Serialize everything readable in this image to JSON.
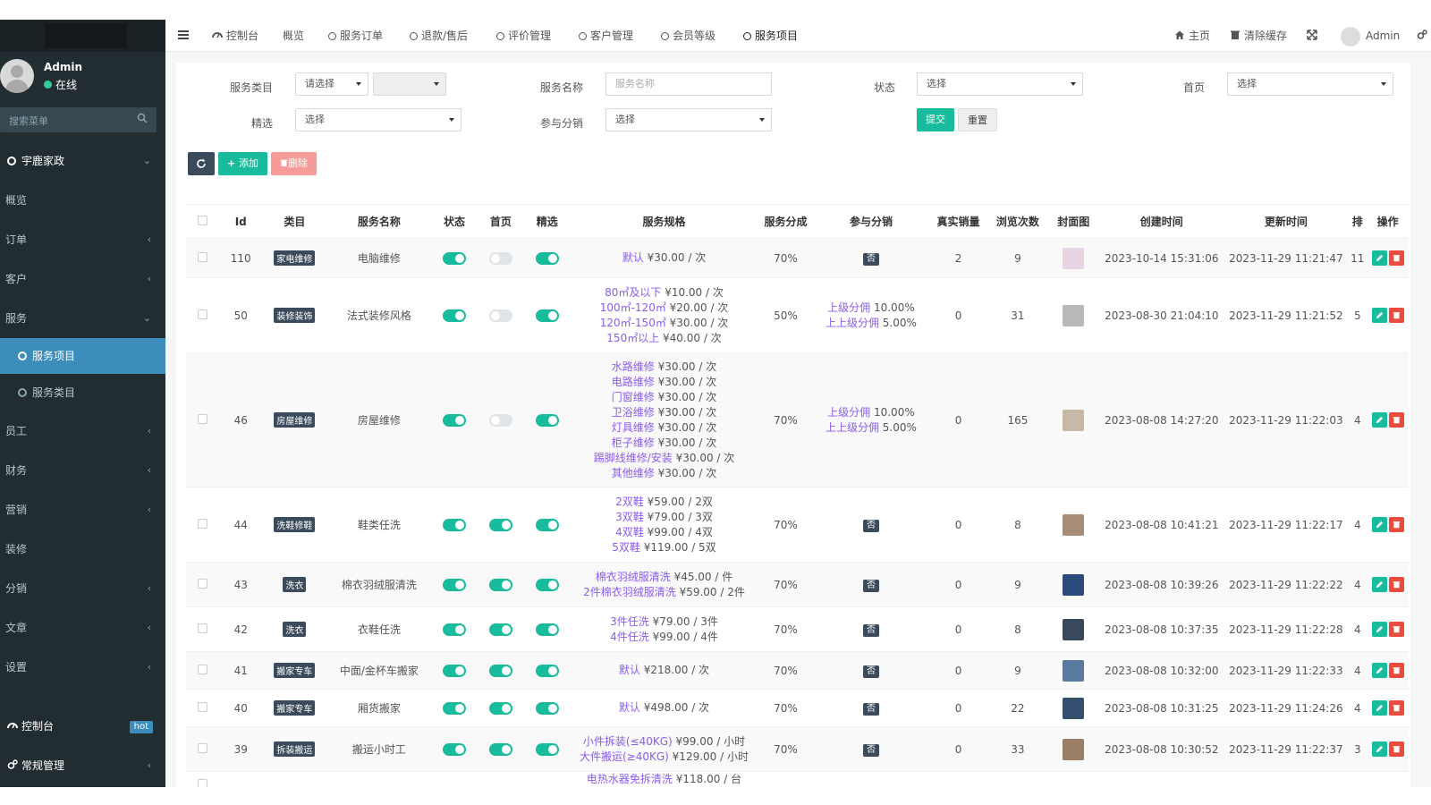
{
  "sidebar": {
    "user": {
      "name": "Admin",
      "status": "在线"
    },
    "search_placeholder": "搜索菜单",
    "items": [
      {
        "label": "宇鹿家政",
        "arrow": "⌄"
      },
      {
        "label": "概览",
        "arrow": ""
      },
      {
        "label": "订单",
        "arrow": "‹"
      },
      {
        "label": "客户",
        "arrow": "‹"
      },
      {
        "label": "服务",
        "arrow": "⌄"
      },
      {
        "label": "服务项目",
        "arrow": ""
      },
      {
        "label": "服务类目",
        "arrow": ""
      },
      {
        "label": "员工",
        "arrow": "‹"
      },
      {
        "label": "财务",
        "arrow": "‹"
      },
      {
        "label": "营销",
        "arrow": "‹"
      },
      {
        "label": "装修",
        "arrow": ""
      },
      {
        "label": "分销",
        "arrow": "‹"
      },
      {
        "label": "文章",
        "arrow": "‹"
      },
      {
        "label": "设置",
        "arrow": "‹"
      }
    ],
    "bottom": [
      {
        "label": "控制台",
        "badge": "hot"
      },
      {
        "label": "常规管理",
        "arrow": "‹"
      }
    ]
  },
  "navbar": {
    "tabs": [
      "控制台",
      "概览",
      "服务订单",
      "退款/售后",
      "评价管理",
      "客户管理",
      "会员等级",
      "服务项目"
    ],
    "right": {
      "home": "主页",
      "clear_cache": "清除缓存",
      "user": "Admin"
    }
  },
  "filters": {
    "category_label": "服务类目",
    "category_value": "请选择",
    "name_label": "服务名称",
    "name_placeholder": "服务名称",
    "status_label": "状态",
    "status_value": "选择",
    "home_label": "首页",
    "home_value": "选择",
    "featured_label": "精选",
    "featured_value": "选择",
    "distribution_label": "参与分销",
    "distribution_value": "选择",
    "submit": "提交",
    "reset": "重置"
  },
  "toolbar": {
    "add": "添加",
    "delete": "删除"
  },
  "table": {
    "headers": [
      "Id",
      "类目",
      "服务名称",
      "状态",
      "首页",
      "精选",
      "服务规格",
      "服务分成",
      "参与分销",
      "真实销量",
      "浏览次数",
      "封面图",
      "创建时间",
      "更新时间",
      "排",
      "操作"
    ],
    "rows": [
      {
        "id": "110",
        "cat": "家电维修",
        "name": "电脑维修",
        "status": true,
        "home": false,
        "featured": true,
        "specs": [
          {
            "k": "默认",
            "v": " ¥30.00 / 次"
          }
        ],
        "share": "70%",
        "dist": [],
        "sales": "2",
        "views": "9",
        "cover": "#e9d4e4",
        "created": "2023-10-14 15:31:06",
        "updated": "2023-11-29 11:21:47",
        "sort": "11"
      },
      {
        "id": "50",
        "cat": "装修装饰",
        "name": "法式装修风格",
        "status": true,
        "home": false,
        "featured": true,
        "specs": [
          {
            "k": "80㎡及以下",
            "v": " ¥10.00 / 次"
          },
          {
            "k": "100㎡-120㎡",
            "v": " ¥20.00 / 次"
          },
          {
            "k": "120㎡-150㎡",
            "v": " ¥30.00 / 次"
          },
          {
            "k": "150㎡以上",
            "v": " ¥40.00 / 次"
          }
        ],
        "share": "50%",
        "dist": [
          {
            "k": "上级分佣",
            "v": " 10.00%"
          },
          {
            "k": "上上级分佣",
            "v": " 5.00%"
          }
        ],
        "sales": "0",
        "views": "31",
        "cover": "#b9b9b9",
        "created": "2023-08-30 21:04:10",
        "updated": "2023-11-29 11:21:52",
        "sort": "5"
      },
      {
        "id": "46",
        "cat": "房屋维修",
        "name": "房屋维修",
        "status": true,
        "home": false,
        "featured": true,
        "specs": [
          {
            "k": "水路维修",
            "v": " ¥30.00 / 次"
          },
          {
            "k": "电路维修",
            "v": " ¥30.00 / 次"
          },
          {
            "k": "门窗维修",
            "v": " ¥30.00 / 次"
          },
          {
            "k": "卫浴维修",
            "v": " ¥30.00 / 次"
          },
          {
            "k": "灯具维修",
            "v": " ¥30.00 / 次"
          },
          {
            "k": "柜子维修",
            "v": " ¥30.00 / 次"
          },
          {
            "k": "踢脚线维修/安装",
            "v": " ¥30.00 / 次"
          },
          {
            "k": "其他维修",
            "v": " ¥30.00 / 次"
          }
        ],
        "share": "70%",
        "dist": [
          {
            "k": "上级分佣",
            "v": " 10.00%"
          },
          {
            "k": "上上级分佣",
            "v": " 5.00%"
          }
        ],
        "sales": "0",
        "views": "165",
        "cover": "#c8b8a8",
        "created": "2023-08-08 14:27:20",
        "updated": "2023-11-29 11:22:03",
        "sort": "4"
      },
      {
        "id": "44",
        "cat": "洗鞋修鞋",
        "name": "鞋类任洗",
        "status": true,
        "home": true,
        "featured": true,
        "specs": [
          {
            "k": "2双鞋",
            "v": " ¥59.00 / 2双"
          },
          {
            "k": "3双鞋",
            "v": " ¥79.00 / 3双"
          },
          {
            "k": "4双鞋",
            "v": " ¥99.00 / 4双"
          },
          {
            "k": "5双鞋",
            "v": " ¥119.00 / 5双"
          }
        ],
        "share": "70%",
        "dist": [],
        "sales": "0",
        "views": "8",
        "cover": "#a88e78",
        "created": "2023-08-08 10:41:21",
        "updated": "2023-11-29 11:22:17",
        "sort": "4"
      },
      {
        "id": "43",
        "cat": "洗衣",
        "name": "棉衣羽绒服清洗",
        "status": true,
        "home": true,
        "featured": true,
        "specs": [
          {
            "k": "棉衣羽绒服清洗",
            "v": " ¥45.00 / 件"
          },
          {
            "k": "2件棉衣羽绒服清洗",
            "v": " ¥59.00 / 2件"
          }
        ],
        "share": "70%",
        "dist": [],
        "sales": "0",
        "views": "9",
        "cover": "#2c4a7a",
        "created": "2023-08-08 10:39:26",
        "updated": "2023-11-29 11:22:22",
        "sort": "4"
      },
      {
        "id": "42",
        "cat": "洗衣",
        "name": "衣鞋任洗",
        "status": true,
        "home": true,
        "featured": true,
        "specs": [
          {
            "k": "3件任洗",
            "v": " ¥79.00 / 3件"
          },
          {
            "k": "4件任洗",
            "v": " ¥99.00 / 4件"
          }
        ],
        "share": "70%",
        "dist": [],
        "sales": "0",
        "views": "8",
        "cover": "#3a4a5e",
        "created": "2023-08-08 10:37:35",
        "updated": "2023-11-29 11:22:28",
        "sort": "4"
      },
      {
        "id": "41",
        "cat": "搬家专车",
        "name": "中面/金杯车搬家",
        "status": true,
        "home": true,
        "featured": true,
        "specs": [
          {
            "k": "默认",
            "v": " ¥218.00 / 次"
          }
        ],
        "share": "70%",
        "dist": [],
        "sales": "0",
        "views": "9",
        "cover": "#5a7aa0",
        "created": "2023-08-08 10:32:00",
        "updated": "2023-11-29 11:22:33",
        "sort": "4"
      },
      {
        "id": "40",
        "cat": "搬家专车",
        "name": "厢货搬家",
        "status": true,
        "home": true,
        "featured": true,
        "specs": [
          {
            "k": "默认",
            "v": " ¥498.00 / 次"
          }
        ],
        "share": "70%",
        "dist": [],
        "sales": "0",
        "views": "22",
        "cover": "#34506e",
        "created": "2023-08-08 10:31:25",
        "updated": "2023-11-29 11:24:26",
        "sort": "4"
      },
      {
        "id": "39",
        "cat": "拆装搬运",
        "name": "搬运小时工",
        "status": true,
        "home": true,
        "featured": true,
        "specs": [
          {
            "k": "小件拆装(≤40KG)",
            "v": " ¥99.00 / 小时"
          },
          {
            "k": "大件搬运(≥40KG)",
            "v": " ¥129.00 / 小时"
          }
        ],
        "share": "70%",
        "dist": [],
        "sales": "0",
        "views": "33",
        "cover": "#9a7e66",
        "created": "2023-08-08 10:30:52",
        "updated": "2023-11-29 11:22:37",
        "sort": "3"
      },
      {
        "id": "",
        "cat": "",
        "name": "",
        "status": null,
        "home": null,
        "featured": null,
        "specs": [
          {
            "k": "电热水器免拆清洗",
            "v": " ¥118.00 / 台"
          }
        ],
        "share": "",
        "dist": null,
        "sales": "",
        "views": "",
        "cover": "",
        "created": "",
        "updated": "",
        "sort": ""
      }
    ],
    "no_label": "否"
  }
}
